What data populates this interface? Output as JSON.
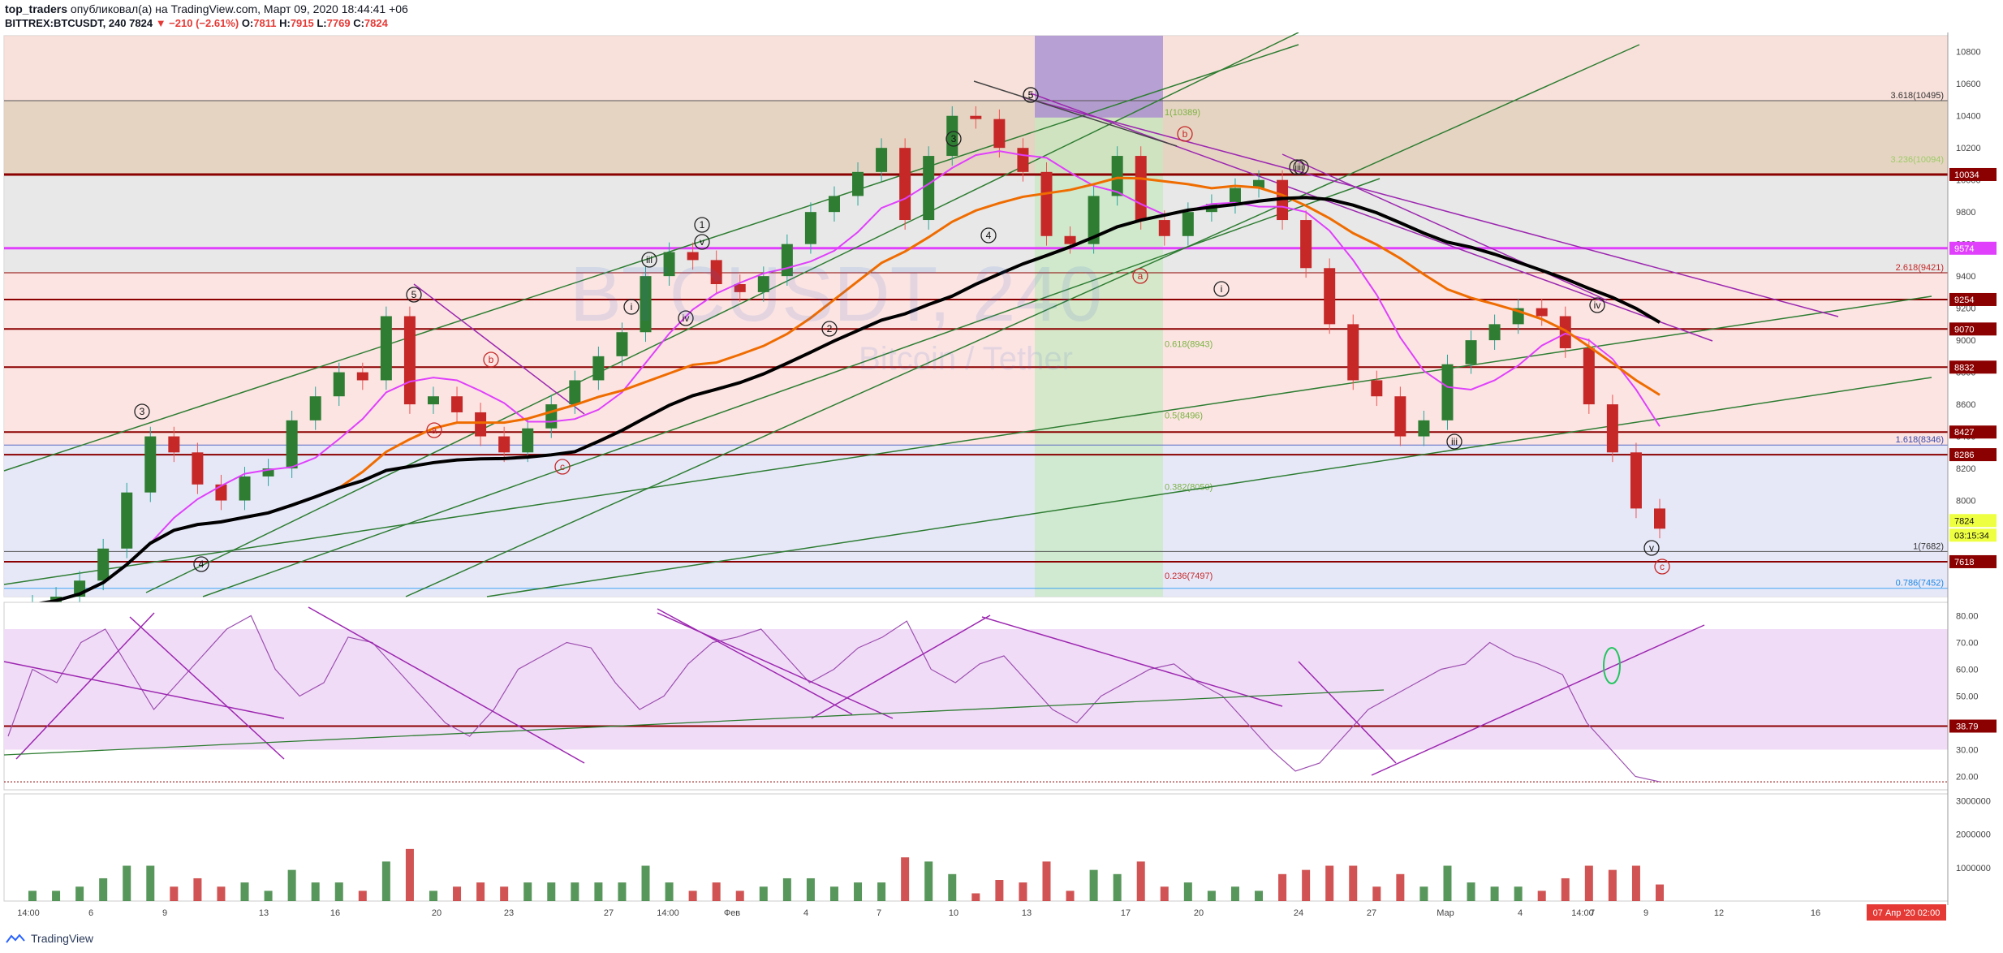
{
  "header": {
    "author": "top_traders",
    "published": "опубликовал(а) на TradingView.com, Март 09, 2020 18:44:41 +06",
    "symbol": "BITTREX:BTCUSDT, 240",
    "last": "7824",
    "change": "▼ −210 (−2.61%)",
    "o_label": "O:",
    "o": "7811",
    "h_label": "H:",
    "h": "7915",
    "l_label": "L:",
    "l": "7769",
    "c_label": "C:",
    "c": "7824"
  },
  "watermark": {
    "symbol": "BTCUSDT, 240",
    "name": "Bitcoin / Tether"
  },
  "colors": {
    "red_line": "#8b0000",
    "magenta": "#e040fb",
    "purple": "#9c27b0",
    "green": "#2e7d32",
    "orange": "#ef6c00",
    "black": "#000000",
    "up": "#26a69a",
    "down": "#ef5350"
  },
  "chart_data": [
    {
      "type": "candlestick",
      "pane": "price",
      "yaxis_ticks": [
        "10800",
        "10600",
        "10400",
        "10200",
        "10000",
        "9800",
        "9600",
        "9400",
        "9200",
        "9000",
        "8800",
        "8600",
        "8400",
        "8200",
        "8000",
        "7800"
      ],
      "ylim": [
        7400,
        10900
      ],
      "xaxis_ticks": [
        "14:00",
        "6",
        "9",
        "13",
        "16",
        "20",
        "23",
        "27",
        "14:00",
        "Фев",
        "4",
        "7",
        "10",
        "13",
        "17",
        "20",
        "24",
        "27",
        "Мар",
        "4",
        "7",
        "14:00",
        "9",
        "12",
        "16",
        "19"
      ],
      "close_series": [
        7350,
        7400,
        7500,
        7700,
        8050,
        8400,
        8300,
        8100,
        8000,
        8150,
        8200,
        8500,
        8650,
        8800,
        8750,
        9150,
        8600,
        8650,
        8550,
        8400,
        8300,
        8450,
        8600,
        8750,
        8900,
        9050,
        9400,
        9550,
        9500,
        9350,
        9300,
        9400,
        9600,
        9800,
        9900,
        10050,
        10200,
        9750,
        10150,
        10400,
        10380,
        10200,
        10050,
        9650,
        9600,
        9900,
        10150,
        9750,
        9650,
        9800,
        9850,
        9950,
        10000,
        9750,
        9450,
        9100,
        8750,
        8650,
        8400,
        8500,
        8850,
        9000,
        9100,
        9200,
        9150,
        8950,
        8600,
        8300,
        7950,
        7824
      ],
      "price_labels": [
        {
          "value": "10034",
          "kind": "line"
        },
        {
          "value": "9574",
          "kind": "magenta"
        },
        {
          "value": "9254",
          "kind": "line"
        },
        {
          "value": "9070",
          "kind": "line"
        },
        {
          "value": "8832",
          "kind": "line"
        },
        {
          "value": "8427",
          "kind": "line"
        },
        {
          "value": "8286",
          "kind": "line"
        },
        {
          "value": "7824",
          "kind": "last"
        },
        {
          "value": "03:15:34",
          "kind": "countdown"
        },
        {
          "value": "7618",
          "kind": "line"
        }
      ],
      "fib_labels": [
        "3.618(10495)",
        "3.236(10094)",
        "2.618(9421)",
        "1.618(8346)",
        "1(7682)",
        "0.786(7452)",
        "1(10389)",
        "0.618(8943)",
        "0.5(8496)",
        "0.382(8050)",
        "0.236(7497)"
      ],
      "wave_labels": [
        "3",
        "4",
        "5",
        "5",
        "a",
        "b",
        "c",
        "1",
        "2",
        "3",
        "4",
        "5",
        "i",
        "ii",
        "iii",
        "iv",
        "v",
        "a",
        "b",
        "c",
        "i",
        "ii",
        "iii",
        "iv",
        "v"
      ]
    },
    {
      "type": "line",
      "pane": "rsi",
      "yaxis_ticks": [
        "80.00",
        "70.00",
        "60.00",
        "50.00",
        "40.00",
        "30.00",
        "20.00"
      ],
      "ylim": [
        15,
        85
      ],
      "last_value": "38.79",
      "values": [
        35,
        60,
        55,
        70,
        75,
        60,
        45,
        55,
        65,
        75,
        80,
        60,
        50,
        55,
        72,
        70,
        60,
        50,
        40,
        35,
        45,
        60,
        65,
        70,
        68,
        55,
        45,
        50,
        62,
        70,
        72,
        75,
        65,
        55,
        60,
        68,
        72,
        78,
        60,
        55,
        62,
        65,
        55,
        45,
        40,
        50,
        55,
        60,
        62,
        55,
        50,
        40,
        30,
        22,
        25,
        35,
        45,
        50,
        55,
        60,
        62,
        70,
        65,
        62,
        58,
        40,
        30,
        20,
        18
      ]
    },
    {
      "type": "bar",
      "pane": "volume",
      "yaxis_ticks": [
        "3000000",
        "2000000",
        "1000000"
      ],
      "ylim": [
        0,
        3200000
      ]
    }
  ],
  "footer": {
    "date_badge": "07 Апр '20  02:00",
    "logo": "TradingView"
  }
}
